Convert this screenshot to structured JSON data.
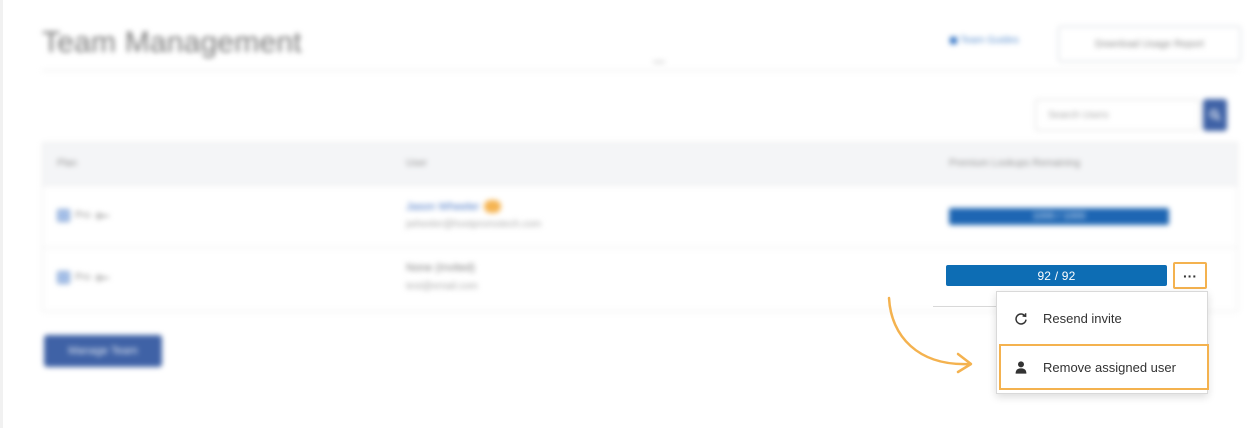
{
  "header": {
    "title": "Team Management",
    "guides_label": "Team Guides",
    "report_button": "Download Usage Report"
  },
  "search": {
    "placeholder": "Search Users"
  },
  "table": {
    "columns": [
      "Plan",
      "User",
      "Premium Lookups Remaining"
    ],
    "rows": [
      {
        "plan": "Pro",
        "user_name": "Jason Wheeler",
        "user_email": "jwheeler@hostpromotech.com",
        "lookups": "1000 / 1000"
      },
      {
        "plan": "Pro",
        "user_name": "None (Invited)",
        "user_email": "test@email.com",
        "lookups": "92 / 92"
      }
    ]
  },
  "manage_button": "Manage Team",
  "row_menu": {
    "more_label": "···",
    "items": [
      {
        "label": "Resend invite",
        "icon": "refresh-icon"
      },
      {
        "label": "Remove assigned user",
        "icon": "user-icon"
      }
    ]
  },
  "colors": {
    "accent": "#f4b24f",
    "primary_blue": "#3f62a6",
    "bar_blue": "#0d6db4"
  }
}
